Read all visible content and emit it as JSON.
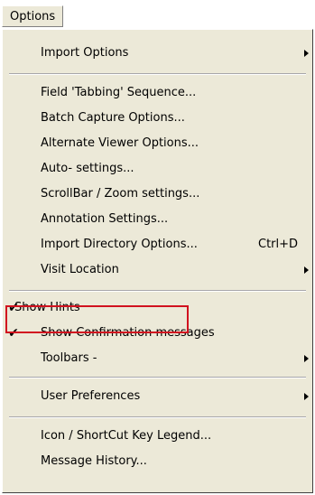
{
  "menubar": {
    "title": "Options"
  },
  "menu": {
    "items": [
      {
        "label": "Import Options",
        "submenu": true
      },
      {
        "label": "Field 'Tabbing' Sequence..."
      },
      {
        "label": "Batch Capture Options..."
      },
      {
        "label": "Alternate Viewer Options..."
      },
      {
        "label": "Auto- settings..."
      },
      {
        "label": "ScrollBar / Zoom settings..."
      },
      {
        "label": "Annotation Settings..."
      },
      {
        "label": "Import Directory Options...",
        "shortcut": "Ctrl+D"
      },
      {
        "label": "Visit Location",
        "submenu": true
      },
      {
        "label": "Show Hints",
        "checked": true,
        "check_symbol": "✔",
        "highlighted": true
      },
      {
        "label": "Show Confirmation messages",
        "checked": true,
        "check_symbol": "✔"
      },
      {
        "label": "Toolbars -",
        "submenu": true
      },
      {
        "label": "User Preferences",
        "submenu": true
      },
      {
        "label": "Icon / ShortCut Key Legend..."
      },
      {
        "label": "Message History..."
      }
    ]
  },
  "colors": {
    "menu_background": "#ece9d8",
    "highlight_border": "#d1121f"
  }
}
